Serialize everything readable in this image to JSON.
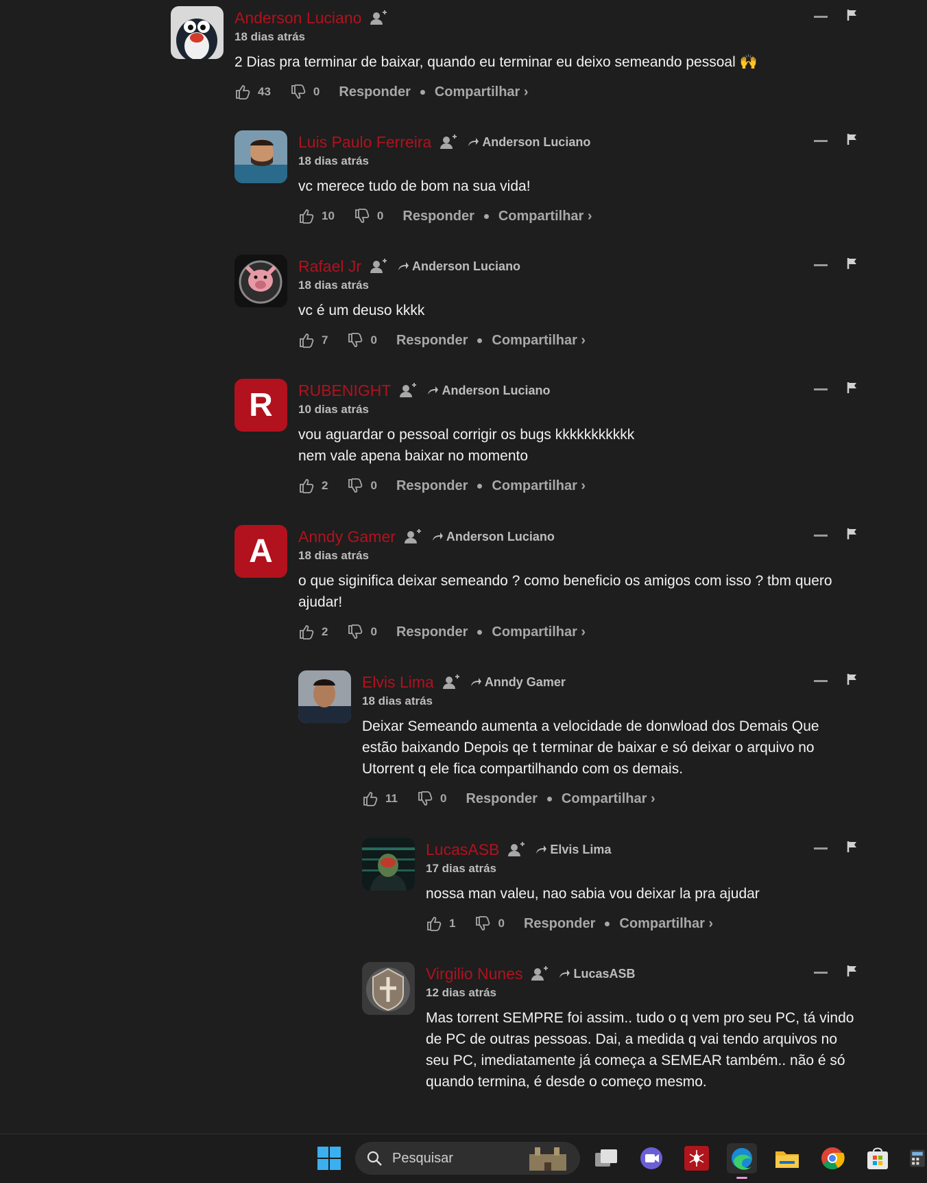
{
  "comments": [
    {
      "author": "Anderson Luciano",
      "reply_to": "",
      "time": "18 dias atrás",
      "text": "2 Dias pra terminar de baixar, quando eu terminar eu deixo semeando pessoal 🙌",
      "likes": "43",
      "dislikes": "0",
      "avatar": "penguin"
    },
    {
      "author": "Luis Paulo Ferreira",
      "reply_to": "Anderson Luciano",
      "time": "18 dias atrás",
      "text": "vc merece tudo de bom na sua vida!",
      "likes": "10",
      "dislikes": "0",
      "avatar": "photo-man"
    },
    {
      "author": "Rafael Jr",
      "reply_to": "Anderson Luciano",
      "time": "18 dias atrás",
      "text": "vc é um deuso kkkk",
      "likes": "7",
      "dislikes": "0",
      "avatar": "pig-logo"
    },
    {
      "author": "RUBENIGHT",
      "reply_to": "Anderson Luciano",
      "time": "10 dias atrás",
      "text": "vou aguardar o pessoal corrigir os bugs kkkkkkkkkkk\nnem vale apena baixar no momento",
      "likes": "2",
      "dislikes": "0",
      "avatar_letter": "R"
    },
    {
      "author": "Anndy Gamer",
      "reply_to": "Anderson Luciano",
      "time": "18 dias atrás",
      "text": "o que siginifica deixar semeando ? como beneficio os amigos com isso ? tbm quero ajudar!",
      "likes": "2",
      "dislikes": "0",
      "avatar_letter": "A"
    },
    {
      "author": "Elvis Lima",
      "reply_to": "Anndy Gamer",
      "time": "18 dias atrás",
      "text": "Deixar Semeando aumenta a velocidade de donwload dos Demais Que estão baixando Depois qe t terminar de baixar e só deixar o arquivo no Utorrent q ele fica compartilhando com os demais.",
      "likes": "11",
      "dislikes": "0",
      "avatar": "photo-man2"
    },
    {
      "author": "LucasASB",
      "reply_to": "Elvis Lima",
      "time": "17 dias atrás",
      "text": "nossa man valeu, nao sabia vou deixar la pra ajudar",
      "likes": "1",
      "dislikes": "0",
      "avatar": "hacker"
    },
    {
      "author": "Virgilio Nunes",
      "reply_to": "LucasASB",
      "time": "12 dias atrás",
      "text": "Mas torrent SEMPRE foi assim.. tudo o q vem pro seu PC, tá vindo de PC de outras pessoas. Dai, a medida q vai tendo arquivos no seu PC, imediatamente já começa a SEMEAR também.. não é só quando termina, é desde o começo mesmo.",
      "likes": "",
      "dislikes": "",
      "avatar": "emblem"
    }
  ],
  "labels": {
    "reply": "Responder",
    "share": "Compartilhar ›"
  },
  "taskbar": {
    "search_placeholder": "Pesquisar"
  },
  "colors": {
    "author": "#b1121d",
    "background": "#1e1e1e",
    "text": "#f2f2f2",
    "muted": "#a8a8a8"
  },
  "icons": [
    "windows-start-icon",
    "search-icon",
    "task-view-icon",
    "teams-icon",
    "spiderman-game-icon",
    "edge-icon",
    "file-explorer-icon",
    "chrome-icon",
    "microsoft-store-icon",
    "calculator-icon"
  ]
}
